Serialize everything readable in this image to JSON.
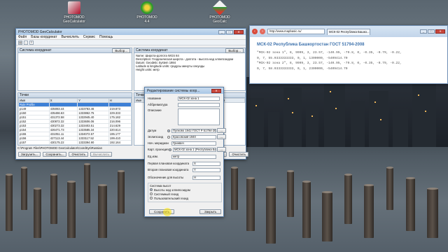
{
  "desktop": {
    "icons": [
      {
        "label": "PHOTOMOD\nGeoCalculator",
        "color": "#b0102a"
      },
      {
        "label": "PHOTOMOD\n4.4",
        "color": "#2b9a2b"
      },
      {
        "label": "PHOTOMOD\nGeoCalc",
        "color": "#2a9b3a"
      }
    ]
  },
  "geocalc": {
    "title": "PHOTOMOD GeoCalculator",
    "menu": [
      "Файл",
      "Базы координат",
      "Вычислить",
      "Сервис",
      "Помощь"
    ],
    "left_panel": {
      "header": "Система координат",
      "button": "Выбор..."
    },
    "right_panel": {
      "header": "Система координат",
      "button": "Выбор...",
      "lines": [
        "Name: Широта-долгота WGS 84",
        "Description: Геодезическая широта - долгота - высота над эллипсоидом",
        "Datum: Geodetic System 1984",
        "Latitude & longitude units: градусы минуты секунды",
        "Height units: метр"
      ]
    },
    "left_table": {
      "header": "Точки",
      "columns": [
        "Имя",
        "X",
        "Y",
        "H"
      ],
      "rows": [
        [
          "Rule Profile",
          "",
          "",
          ""
        ],
        [
          "p149",
          "435083.44",
          "1333783.46",
          "219.873"
        ],
        [
          "p150",
          "435466.63",
          "1333862.75",
          "229.333"
        ],
        [
          "p151",
          "431372.58",
          "1332945.40",
          "175.182"
        ],
        [
          "p152",
          "430872.32",
          "1333606.06",
          "216.096"
        ],
        [
          "p153",
          "430273.32",
          "1333403.51",
          "214.629"
        ],
        [
          "p154",
          "426471.73",
          "1333585.34",
          "220.614"
        ],
        [
          "p155",
          "431051.11",
          "1334072.57",
          "195.177"
        ],
        [
          "p156",
          "427113.44",
          "1333117.52",
          "199.410"
        ],
        [
          "p157",
          "430175.22",
          "1333394.90",
          "192.164"
        ]
      ]
    },
    "right_table": {
      "header": "Точки",
      "columns": [
        "Имя",
        "X",
        "Y",
        "H"
      ]
    },
    "path": "C:\\Program Files\\PHOTOMOD GeoCalculator\\CoordSys\\Russian",
    "buttons_left": [
      "Загрузить...",
      "Сохранить...",
      "Очистить",
      "Вычислить"
    ],
    "buttons_right": [
      "Загрузить...",
      "Сохранить...",
      "Очистить"
    ]
  },
  "dialog": {
    "title": "Редактирование системы коор...",
    "fields": [
      {
        "label": "Название",
        "value": "МСК-02 зона 1"
      },
      {
        "label": "Аббревиатура",
        "value": ""
      },
      {
        "label": "Описание",
        "value": ""
      }
    ],
    "datum": {
      "label": "Датум",
      "value": "Пулково 1942 ГОСТ Р 51794-2008"
    },
    "ellipsoid": {
      "label": "Эллипсоид",
      "value": "Красовский 1940"
    },
    "prime": {
      "label": "Нач. меридиан",
      "value": "Гринвич"
    },
    "projection": {
      "label": "Карт. проекция",
      "value": "МСК-02 зона 1 (Республика Башки..."
    },
    "units": {
      "label": "Ед.изм.",
      "value": "метр"
    },
    "first_coord": {
      "label": "Первая плановая координата",
      "value": "X"
    },
    "second_coord": {
      "label": "Вторая плановая координата",
      "value": "Y"
    },
    "height_coord": {
      "label": "Обозначение для высоты",
      "value": "H"
    },
    "height_system": {
      "label": "Система высот",
      "options": [
        "Высоты над эллипсоидом",
        "Системный геоид",
        "Пользовательский геоид"
      ],
      "selected": 0
    },
    "save": "Сохранить",
    "close": "Закрыть"
  },
  "browser": {
    "url": "http://www.mapbasic.ru/",
    "tab": "МСК-02 Республика Башко...",
    "heading": "МСК-02 Республика Башкортостан ГОСТ 51794-2008",
    "lines": [
      "\"МСК-02 зона 1\", 8, 9999, 3, 23.57, -140.95, -79.8, 0, -0.35, -0.79, -0.22,",
      "0, 7, 55.0333333333, 0, 1, 1300000, -5409414.70",
      "\"МСК-02 зона 2\", 8, 9999, 3, 23.57, -140.95, -79.8, 0, -0.35, -0.79, -0.22,",
      "0, 7, 58.0333333333, 0, 1, 2300000, -5409414.70"
    ]
  }
}
